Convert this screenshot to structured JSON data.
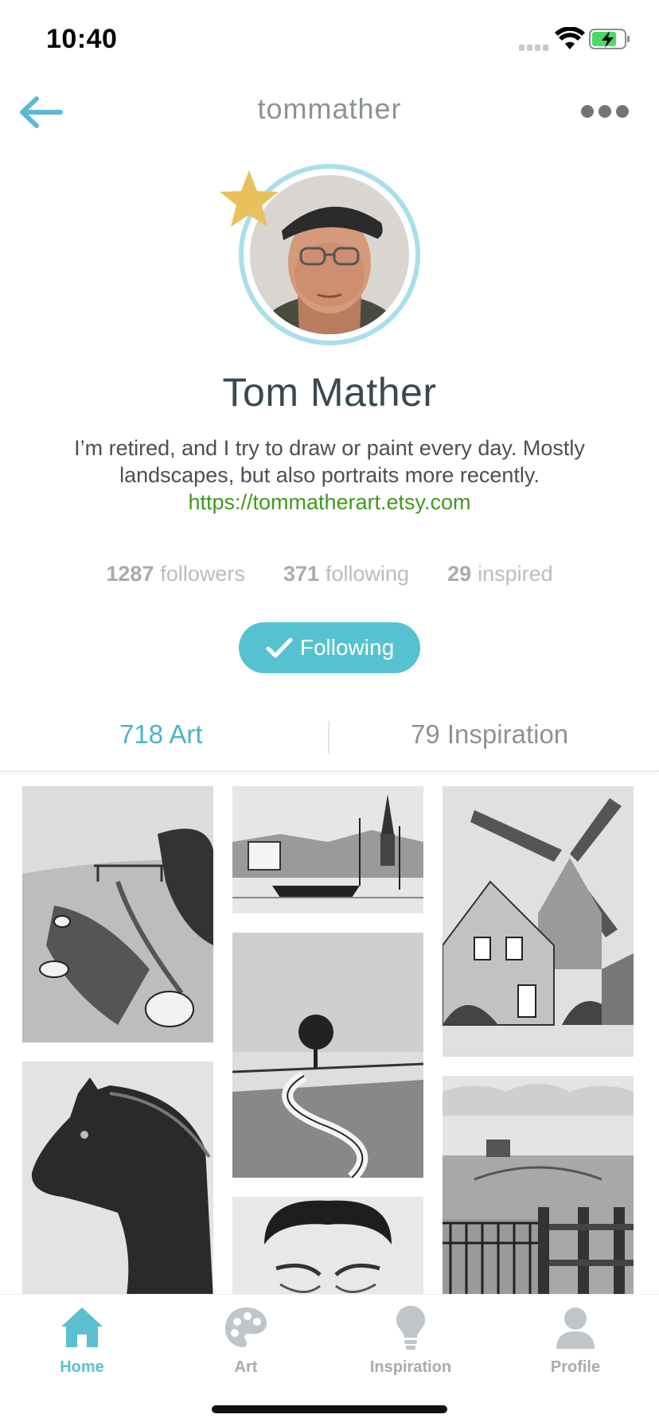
{
  "status_bar": {
    "time": "10:40"
  },
  "nav": {
    "title": "tommather",
    "back_icon": "back-arrow-icon",
    "more_icon": "more-dots-icon"
  },
  "profile": {
    "name": "Tom Mather",
    "bio_text": "I’m retired, and I try to draw or paint every day. Mostly landscapes, but also portraits more recently. ",
    "bio_link": "https://tommatherart.etsy.com",
    "badge_icon": "star-icon"
  },
  "stats": [
    {
      "num": "1287",
      "label": "followers"
    },
    {
      "num": "371",
      "label": "following"
    },
    {
      "num": "29",
      "label": "inspired"
    }
  ],
  "follow_button": {
    "label": "Following",
    "icon": "checkmark-icon"
  },
  "content_tabs": {
    "art": {
      "num": "718",
      "label": "Art",
      "active": true
    },
    "inspiration": {
      "num": "79",
      "label": "Inspiration",
      "active": false
    }
  },
  "gallery": {
    "items": [
      {
        "name": "art-tile-sheep-canal"
      },
      {
        "name": "art-tile-horse"
      },
      {
        "name": "art-tile-harbor-church"
      },
      {
        "name": "art-tile-tree-ditch"
      },
      {
        "name": "art-tile-portrait"
      },
      {
        "name": "art-tile-windmill"
      },
      {
        "name": "art-tile-gate-field"
      }
    ]
  },
  "tab_bar": [
    {
      "label": "Home",
      "icon": "home-icon",
      "active": true
    },
    {
      "label": "Art",
      "icon": "palette-icon",
      "active": false
    },
    {
      "label": "Inspiration",
      "icon": "lightbulb-icon",
      "active": false
    },
    {
      "label": "Profile",
      "icon": "person-icon",
      "active": false
    }
  ],
  "colors": {
    "accent": "#56c2d0",
    "link": "#3e9a1e",
    "star": "#e8c05c",
    "text_muted": "#b8bdc1"
  }
}
